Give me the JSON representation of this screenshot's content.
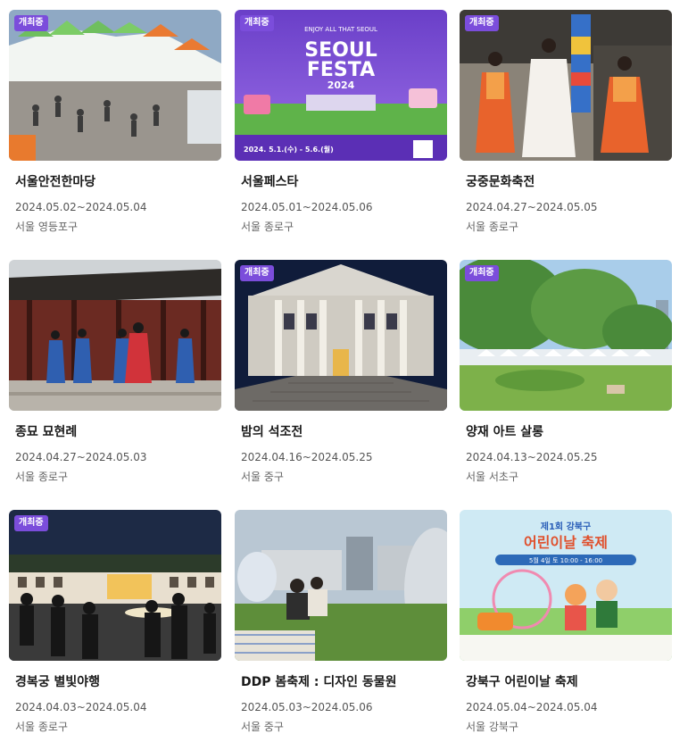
{
  "badge_label": "개최중",
  "cards": [
    {
      "title": "서울안전한마당",
      "date": "2024.05.02~2024.05.04",
      "place": "서울 영등포구",
      "badge": true
    },
    {
      "title": "서울페스타",
      "date": "2024.05.01~2024.05.06",
      "place": "서울 종로구",
      "badge": true,
      "poster": {
        "top": "ENJOY ALL THAT SEOUL",
        "line1": "SEOUL",
        "line2": "FESTA",
        "year": "2024",
        "dates": "2024. 5.1.(수) - 5.6.(월)"
      }
    },
    {
      "title": "궁중문화축전",
      "date": "2024.04.27~2024.05.05",
      "place": "서울 종로구",
      "badge": true
    },
    {
      "title": "종묘 묘현례",
      "date": "2024.04.27~2024.05.03",
      "place": "서울 종로구",
      "badge": false
    },
    {
      "title": "밤의 석조전",
      "date": "2024.04.16~2024.05.25",
      "place": "서울 중구",
      "badge": true
    },
    {
      "title": "양재 아트 살롱",
      "date": "2024.04.13~2024.05.25",
      "place": "서울 서초구",
      "badge": true
    },
    {
      "title": "경복궁 별빛야행",
      "date": "2024.04.03~2024.05.04",
      "place": "서울 종로구",
      "badge": true
    },
    {
      "title": "DDP 봄축제 : 디자인 동물원",
      "date": "2024.05.03~2024.05.06",
      "place": "서울 중구",
      "badge": false
    },
    {
      "title": "강북구 어린이날 축제",
      "date": "2024.05.04~2024.05.04",
      "place": "서울 강북구",
      "badge": false,
      "poster": {
        "top": "제1회 강북구",
        "main": "어린이날 축제",
        "info": "5월 4일 토 10:00 - 16:00"
      }
    }
  ],
  "colors": {
    "badge": "#7b4ddb",
    "poster_purple": "#6a3fc8",
    "poster_green": "#4aa03f"
  }
}
